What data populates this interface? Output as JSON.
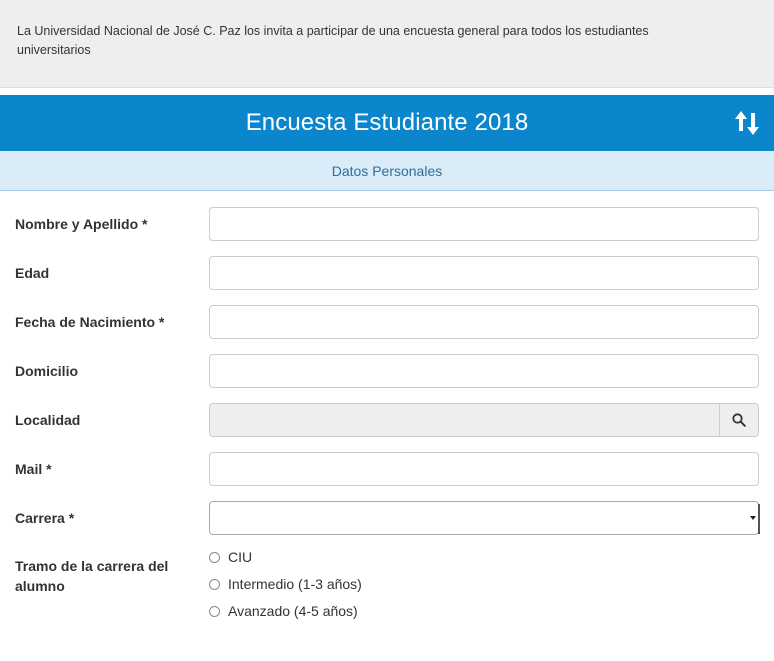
{
  "intro": {
    "text": "La Universidad Nacional de José C. Paz los  invita a participar de una encuesta general para todos los estudiantes universitarios"
  },
  "header": {
    "title": "Encuesta Estudiante 2018",
    "sort_icon": "sort-arrows-icon",
    "color": "#0b86cc"
  },
  "section": {
    "title": "Datos Personales"
  },
  "form": {
    "fields": [
      {
        "label": "Nombre y Apellido *",
        "value": ""
      },
      {
        "label": "Edad",
        "value": ""
      },
      {
        "label": "Fecha de Nacimiento *",
        "value": ""
      },
      {
        "label": "Domicilio",
        "value": ""
      },
      {
        "label": "Localidad",
        "value": "",
        "icon": "search-icon",
        "disabled": true
      },
      {
        "label": "Mail *",
        "value": ""
      },
      {
        "label": "Carrera *",
        "value": "",
        "type": "select"
      }
    ],
    "tramo": {
      "label": "Tramo de la carrera del alumno",
      "options": [
        "CIU",
        "Intermedio (1-3 años)",
        "Avanzado (4-5 años)"
      ]
    }
  }
}
